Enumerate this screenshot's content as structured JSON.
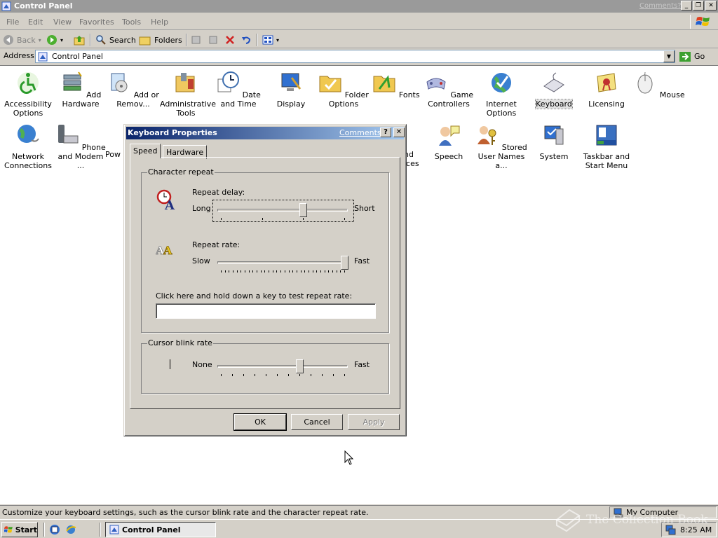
{
  "window": {
    "title": "Control Panel",
    "comments_link": "Comments?"
  },
  "menu": [
    "File",
    "Edit",
    "View",
    "Favorites",
    "Tools",
    "Help"
  ],
  "toolbar": {
    "back": "Back",
    "search": "Search",
    "folders": "Folders"
  },
  "address": {
    "label": "Address",
    "value": "Control Panel",
    "go": "Go"
  },
  "items": [
    {
      "label": "Accessibility Options",
      "icon": "accessibility-icon"
    },
    {
      "label": "Add Hardware",
      "icon": "add-hardware-icon"
    },
    {
      "label": "Add or Remov...",
      "icon": "add-remove-programs-icon"
    },
    {
      "label": "Administrative Tools",
      "icon": "administrative-tools-icon"
    },
    {
      "label": "Date and Time",
      "icon": "date-time-icon"
    },
    {
      "label": "Display",
      "icon": "display-icon"
    },
    {
      "label": "Folder Options",
      "icon": "folder-options-icon"
    },
    {
      "label": "Fonts",
      "icon": "fonts-icon"
    },
    {
      "label": "Game Controllers",
      "icon": "game-controllers-icon"
    },
    {
      "label": "Internet Options",
      "icon": "internet-options-icon"
    },
    {
      "label": "Keyboard",
      "icon": "keyboard-icon"
    },
    {
      "label": "Licensing",
      "icon": "licensing-icon"
    },
    {
      "label": "Mouse",
      "icon": "mouse-icon"
    },
    {
      "label": "Network Connections",
      "icon": "network-connections-icon"
    },
    {
      "label": "Phone and Modem ...",
      "icon": "phone-modem-icon"
    },
    {
      "label": "Pow",
      "icon": "power-options-icon"
    },
    {
      "label": "nd",
      "icon": "sounds-icon"
    },
    {
      "label": "ices",
      "icon": "sounds-icon"
    },
    {
      "label": "Speech",
      "icon": "speech-icon"
    },
    {
      "label": "Stored User Names a...",
      "icon": "stored-user-names-icon"
    },
    {
      "label": "System",
      "icon": "system-icon"
    },
    {
      "label": "Taskbar and Start Menu",
      "icon": "taskbar-start-menu-icon"
    }
  ],
  "dialog": {
    "title": "Keyboard Properties",
    "comments": "Comments?",
    "tabs": [
      "Speed",
      "Hardware"
    ],
    "char_repeat": {
      "legend": "Character repeat",
      "delay_label": "Repeat delay:",
      "delay_min": "Long",
      "delay_max": "Short",
      "rate_label": "Repeat rate:",
      "rate_min": "Slow",
      "rate_max": "Fast",
      "test_label": "Click here and hold down a key to test repeat rate:",
      "test_value": ""
    },
    "cursor_blink": {
      "legend": "Cursor blink rate",
      "min": "None",
      "max": "Fast"
    },
    "buttons": {
      "ok": "OK",
      "cancel": "Cancel",
      "apply": "Apply"
    }
  },
  "status": {
    "text": "Customize your keyboard settings, such as the cursor blink rate and the character repeat rate.",
    "zone": "My Computer"
  },
  "taskbar": {
    "start": "Start",
    "task": "Control Panel",
    "clock": "8:25 AM"
  },
  "watermark": "The Collection Book"
}
